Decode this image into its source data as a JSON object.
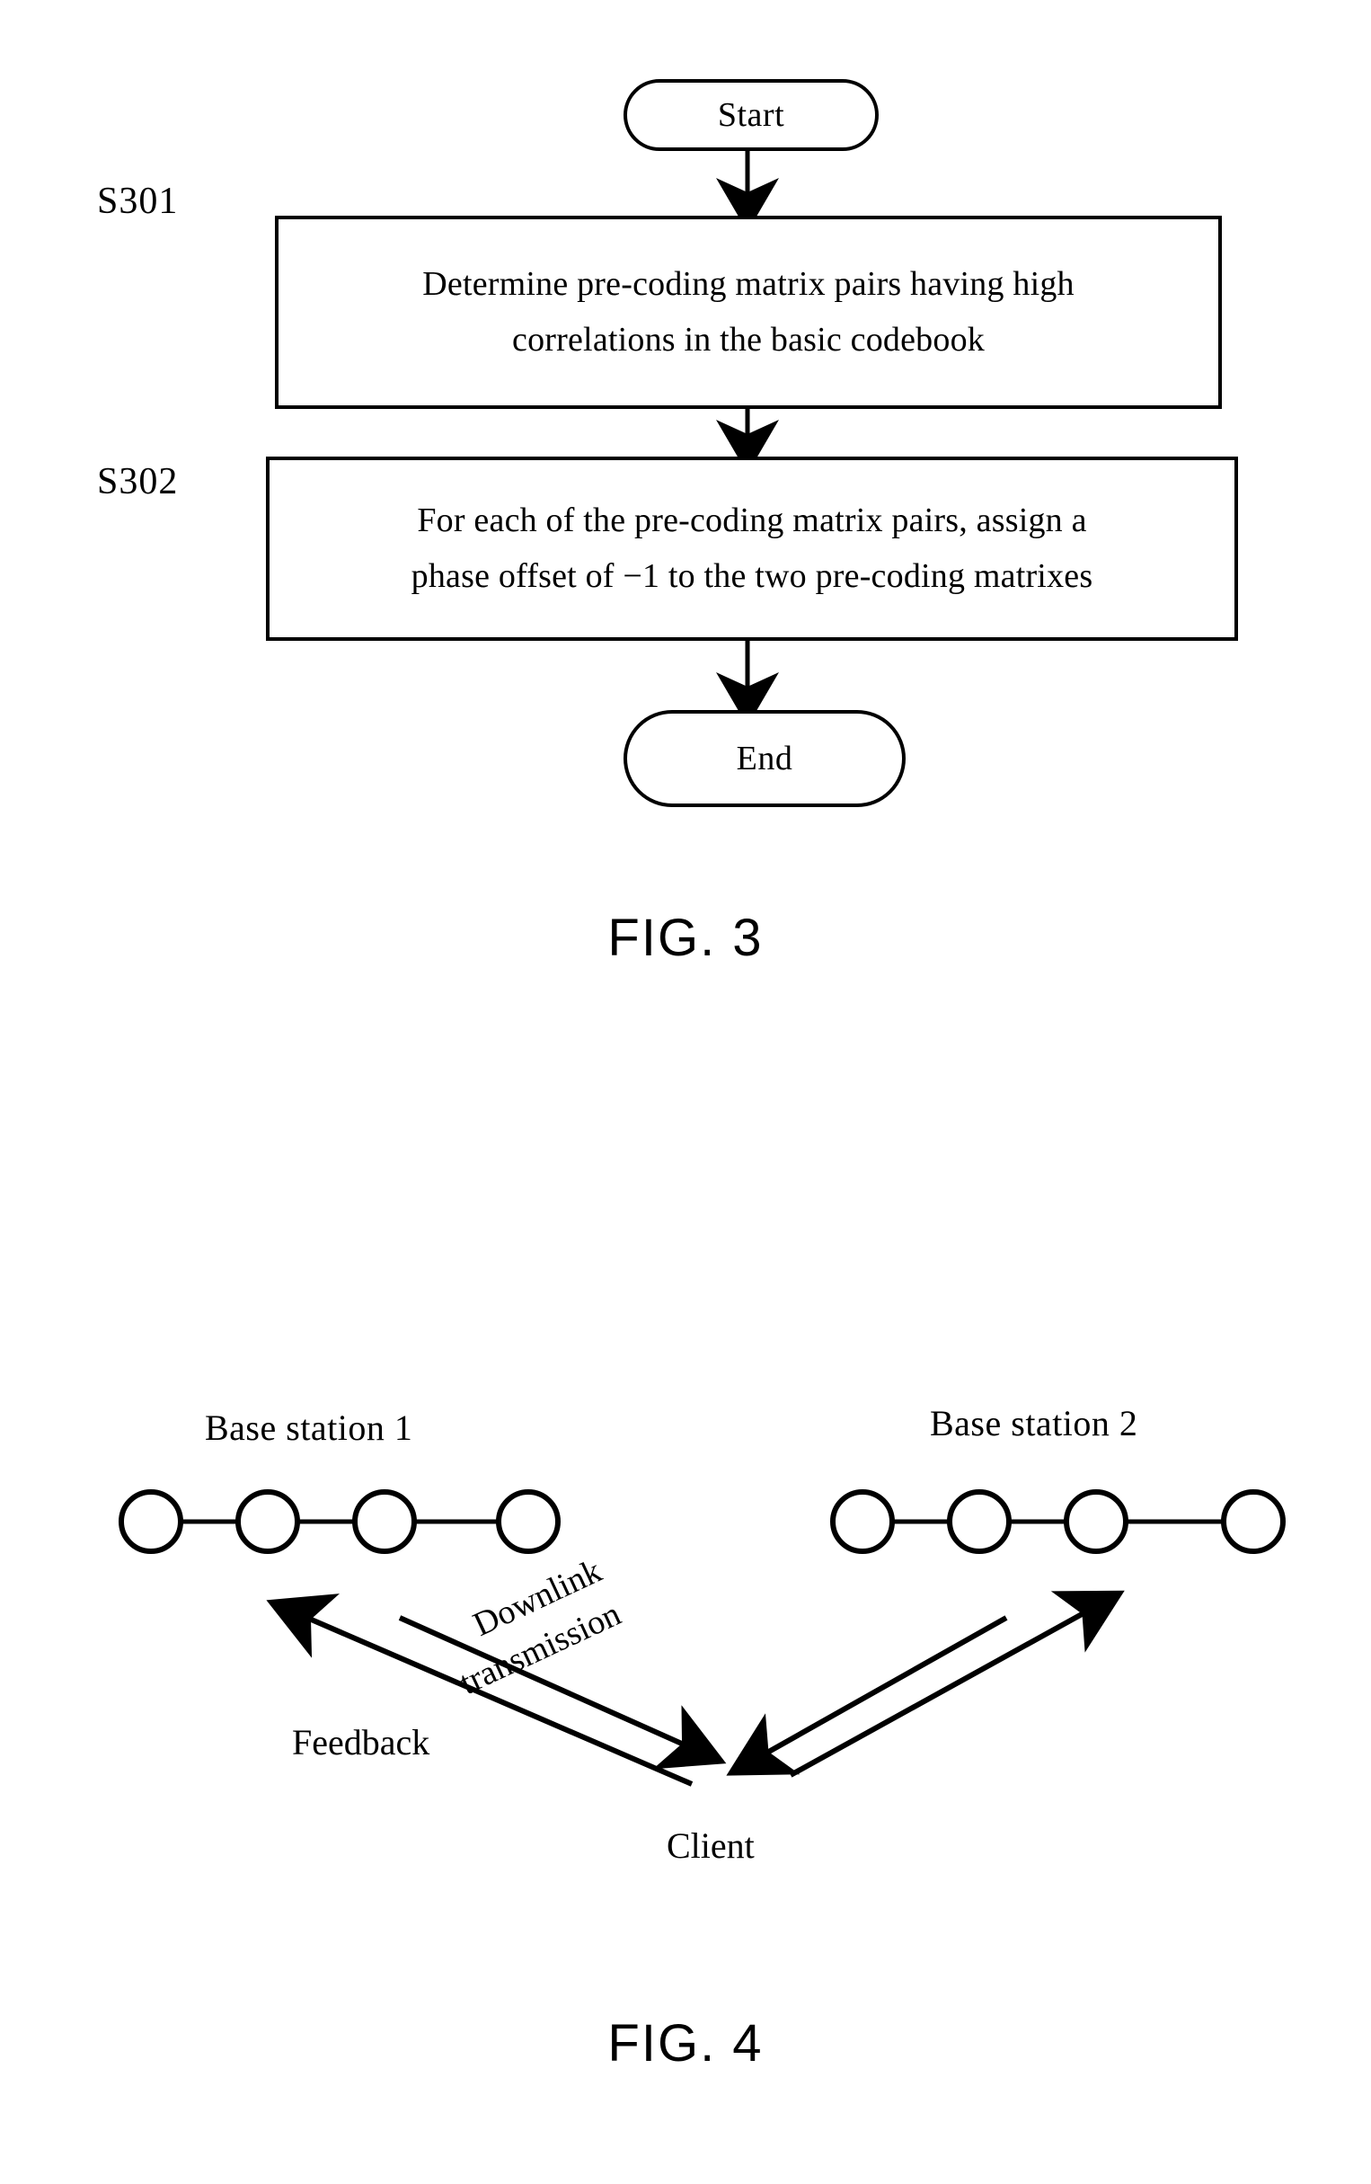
{
  "figure3": {
    "caption": "FIG. 3",
    "start_label": "Start",
    "end_label": "End",
    "steps": [
      {
        "id": "S301",
        "id_label": "S301",
        "lines": [
          "Determine pre-coding matrix pairs having high",
          "correlations in the basic codebook"
        ]
      },
      {
        "id": "S302",
        "id_label": "S302",
        "lines": [
          "For each of the pre-coding matrix pairs, assign a",
          "phase offset of −1 to the two pre-coding matrixes"
        ]
      }
    ]
  },
  "figure4": {
    "caption": "FIG. 4",
    "base_station_1": {
      "title": "Base station 1",
      "antenna_count": 4
    },
    "base_station_2": {
      "title": "Base station 2",
      "antenna_count": 4
    },
    "client_label": "Client",
    "arrow_labels": {
      "feedback": "Feedback",
      "downlink_line1": "Downlink",
      "downlink_line2": "transmission"
    }
  },
  "colors": {
    "ink": "#000000",
    "paper": "#ffffff"
  }
}
